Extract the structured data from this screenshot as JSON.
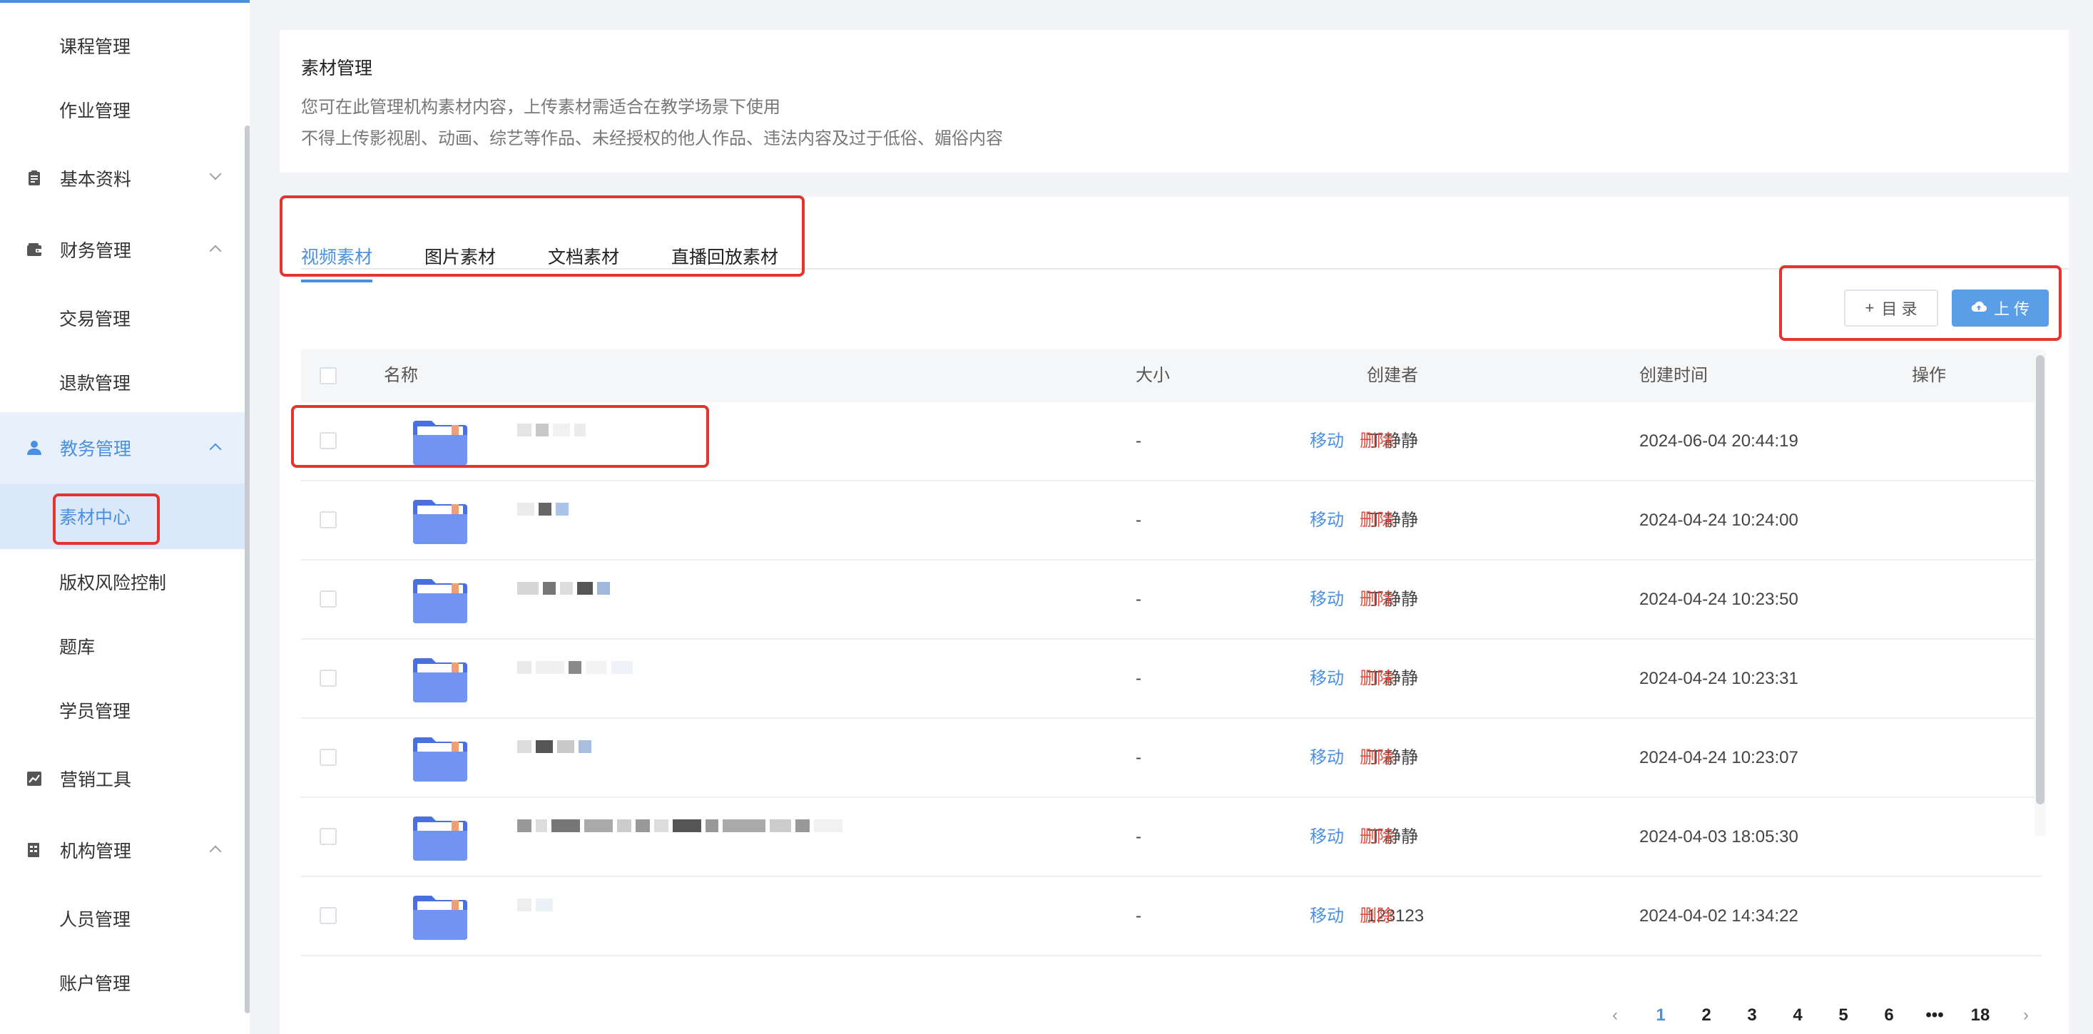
{
  "sidebar": {
    "items": [
      {
        "label": "课程管理",
        "type": "sub"
      },
      {
        "label": "作业管理",
        "type": "sub"
      },
      {
        "label": "基本资料",
        "type": "group",
        "icon": "document-icon",
        "expanded": false
      },
      {
        "label": "财务管理",
        "type": "group",
        "icon": "wallet-icon",
        "expanded": true
      },
      {
        "label": "交易管理",
        "type": "sub"
      },
      {
        "label": "退款管理",
        "type": "sub"
      },
      {
        "label": "教务管理",
        "type": "group",
        "icon": "user-icon",
        "expanded": true,
        "active": true
      },
      {
        "label": "素材中心",
        "type": "sub",
        "active": true
      },
      {
        "label": "版权风险控制",
        "type": "sub"
      },
      {
        "label": "题库",
        "type": "sub"
      },
      {
        "label": "学员管理",
        "type": "sub"
      },
      {
        "label": "营销工具",
        "type": "group",
        "icon": "chart-icon"
      },
      {
        "label": "机构管理",
        "type": "group",
        "icon": "building-icon",
        "expanded": true
      },
      {
        "label": "人员管理",
        "type": "sub"
      },
      {
        "label": "账户管理",
        "type": "sub"
      }
    ]
  },
  "info": {
    "title": "素材管理",
    "line1": "您可在此管理机构素材内容，上传素材需适合在教学场景下使用",
    "line2": "不得上传影视剧、动画、综艺等作品、未经授权的他人作品、违法内容及过于低俗、媚俗内容"
  },
  "tabs": [
    {
      "label": "视频素材",
      "active": true
    },
    {
      "label": "图片素材"
    },
    {
      "label": "文档素材"
    },
    {
      "label": "直播回放素材"
    }
  ],
  "toolbar": {
    "dir_icon": "+",
    "dir_label": "目 录",
    "upload_label": "上 传"
  },
  "table": {
    "columns": {
      "name": "名称",
      "size": "大小",
      "creator": "创建者",
      "created": "创建时间",
      "ops": "操作"
    },
    "move_label": "移动",
    "delete_label": "删除",
    "rows": [
      {
        "size": "-",
        "creator": "丁静静",
        "created": "2024-06-04 20:44:19"
      },
      {
        "size": "-",
        "creator": "丁静静",
        "created": "2024-04-24 10:24:00"
      },
      {
        "size": "-",
        "creator": "丁静静",
        "created": "2024-04-24 10:23:50"
      },
      {
        "size": "-",
        "creator": "丁静静",
        "created": "2024-04-24 10:23:31"
      },
      {
        "size": "-",
        "creator": "丁静静",
        "created": "2024-04-24 10:23:07"
      },
      {
        "size": "-",
        "creator": "丁静静",
        "created": "2024-04-03 18:05:30"
      },
      {
        "size": "-",
        "creator": "123123",
        "created": "2024-04-02 14:34:22"
      }
    ]
  },
  "pagination": {
    "prev": "‹",
    "pages": [
      "1",
      "2",
      "3",
      "4",
      "5",
      "6",
      "•••",
      "18"
    ],
    "next": "›",
    "current": "1"
  },
  "colors": {
    "accent": "#4a90e2",
    "danger": "#e84a3c",
    "highlight": "#e3342f",
    "folder": "#6b8ff0"
  }
}
